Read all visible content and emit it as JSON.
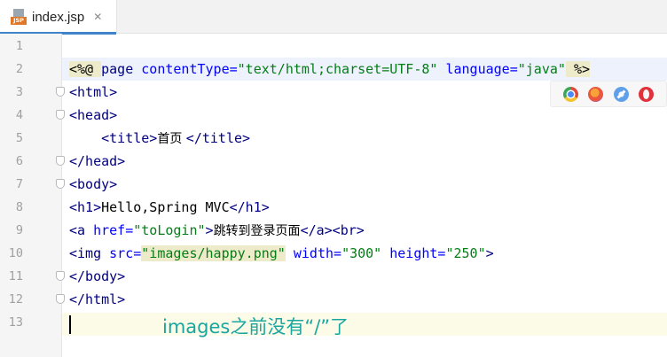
{
  "tab": {
    "title": "index.jsp",
    "icon": "jsp-file-icon",
    "badge": "JSP",
    "close": "✕"
  },
  "line_numbers": [
    "1",
    "2",
    "3",
    "4",
    "5",
    "6",
    "7",
    "8",
    "9",
    "10",
    "11",
    "12",
    "13"
  ],
  "code": {
    "l2": {
      "open": "<%@ ",
      "directive": "page",
      "a1": " contentType=",
      "v1": "\"text/html;charset=UTF-8\"",
      "a2": " language=",
      "v2": "\"java\"",
      "close": " %>"
    },
    "l3": "<html>",
    "l4": "<head>",
    "l5": {
      "indent": "    ",
      "open": "<title>",
      "text": "首页 ",
      "close": "</title>"
    },
    "l6": "</head>",
    "l7": "<body>",
    "l8": {
      "open": "<h1>",
      "text": "Hello,Spring MVC",
      "close": "</h1>"
    },
    "l9": {
      "open": "<a",
      "a1": " href=",
      "v1": "\"toLogin\"",
      "gt": ">",
      "text": "跳转到登录页面",
      "close": "</a><br>"
    },
    "l10": {
      "open": "<img",
      "a1": " src=",
      "v1": "\"images/happy.png\"",
      "a2": " width=",
      "v2": "\"300\"",
      "a3": " height=",
      "v3": "\"250\"",
      "close": ">"
    },
    "l11": "</body>",
    "l12": "</html>"
  },
  "browsers": [
    "chrome-icon",
    "firefox-icon",
    "safari-icon",
    "opera-icon"
  ],
  "annotation": "images之前没有“/”了"
}
